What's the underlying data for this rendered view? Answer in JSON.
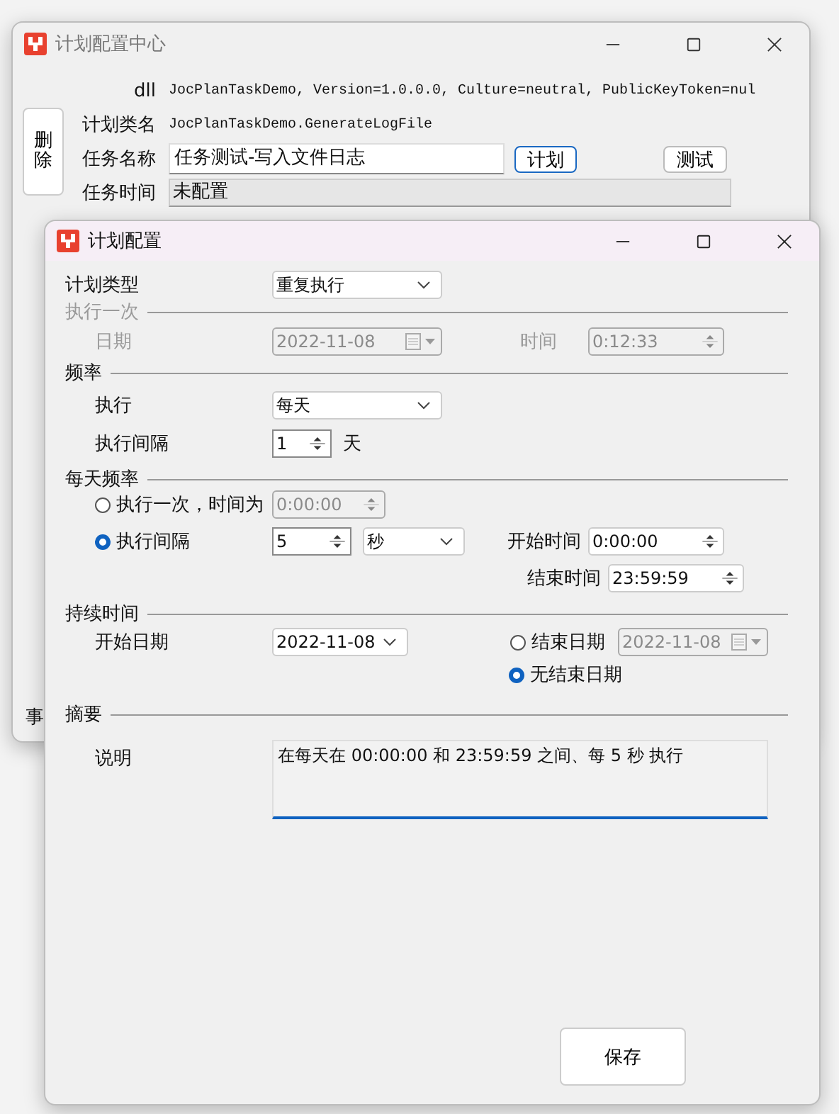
{
  "background": {
    "fragment": "事"
  },
  "main_window": {
    "title": "计划配置中心",
    "delete_button": "删除",
    "fields": [
      {
        "label": "dll",
        "value": "JocPlanTaskDemo, Version=1.0.0.0, Culture=neutral, PublicKeyToken=nul",
        "kind": "text"
      },
      {
        "label": "计划类名",
        "value": "JocPlanTaskDemo.GenerateLogFile",
        "kind": "text"
      },
      {
        "label": "任务名称",
        "value": "任务测试-写入文件日志",
        "kind": "input"
      },
      {
        "label": "任务时间",
        "value": "未配置",
        "kind": "readonly"
      }
    ],
    "plan_button": "计划",
    "test_button": "测试"
  },
  "dialog": {
    "title": "计划配置",
    "plan_type": {
      "label": "计划类型",
      "value": "重复执行"
    },
    "once": {
      "header": "执行一次",
      "disabled": true,
      "date_label": "日期",
      "date": "2022-11-08",
      "time_label": "时间",
      "time": "0:12:33"
    },
    "frequency": {
      "header": "频率",
      "run_label": "执行",
      "run": "每天",
      "interval_label": "执行间隔",
      "interval": "1",
      "unit": "天"
    },
    "daily": {
      "header": "每天频率",
      "options": [
        {
          "label": "执行一次，时间为",
          "selected": false,
          "time": "0:00:00"
        },
        {
          "label": "执行间隔",
          "selected": true,
          "interval": "5",
          "unit": "秒"
        }
      ],
      "start_label": "开始时间",
      "start": "0:00:00",
      "end_label": "结束时间",
      "end": "23:59:59"
    },
    "duration": {
      "header": "持续时间",
      "start_label": "开始日期",
      "start": "2022-11-08",
      "end_options": [
        {
          "label": "结束日期",
          "selected": false,
          "date": "2022-11-08"
        },
        {
          "label": "无结束日期",
          "selected": true
        }
      ]
    },
    "summary": {
      "header": "摘要",
      "label": "说明",
      "text": "在每天在 00:00:00 和 23:59:59 之间、每 5 秒 执行"
    },
    "save_button": "保存"
  }
}
